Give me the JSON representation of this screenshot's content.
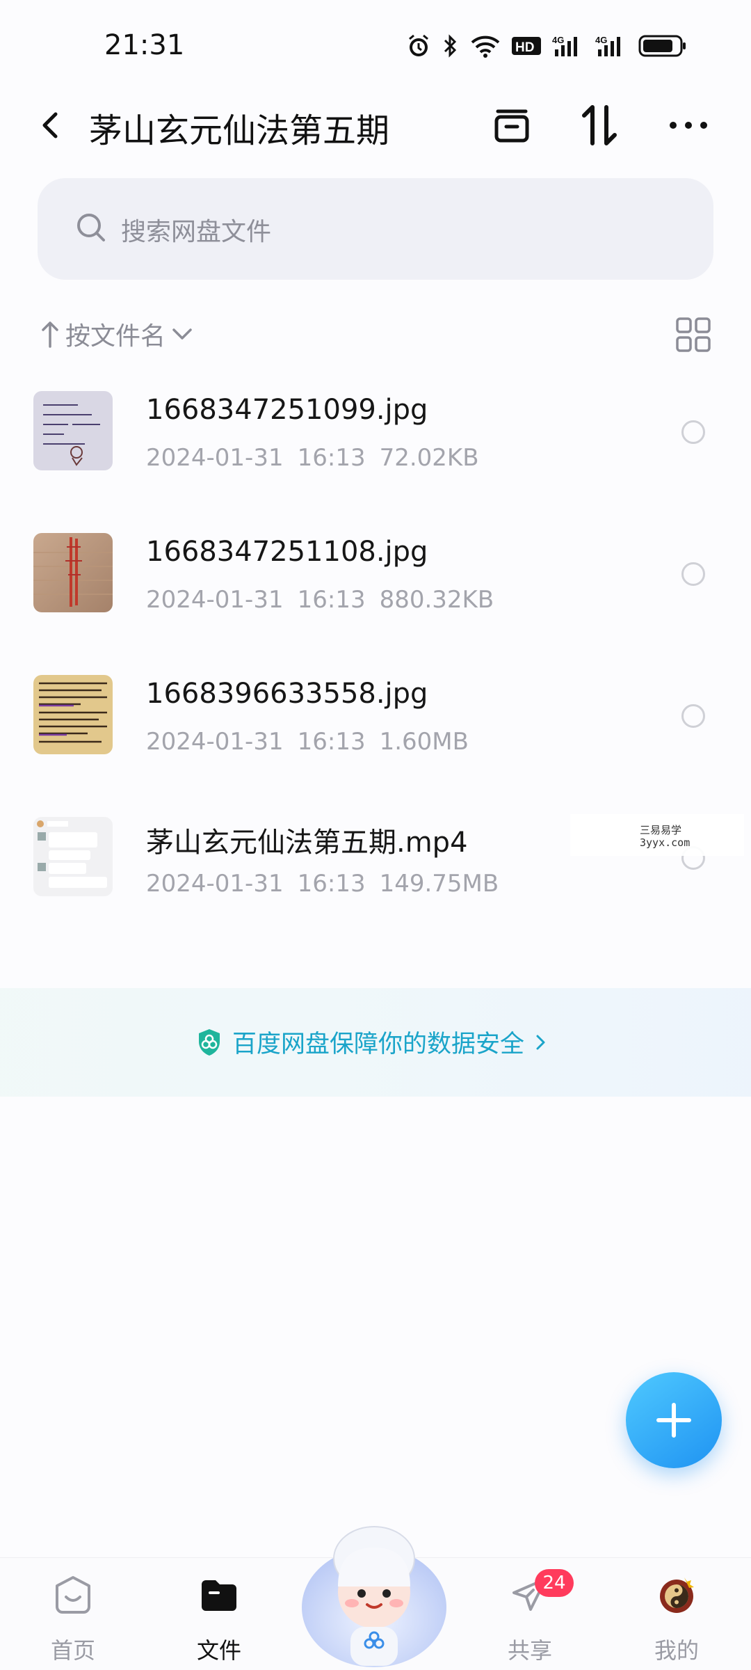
{
  "status_bar": {
    "time": "21:31",
    "icons": [
      "alarm-icon",
      "bluetooth-icon",
      "wifi-icon",
      "hd-icon",
      "signal-4g-icon",
      "signal-4g-icon",
      "battery-icon"
    ],
    "hd_label": "HD",
    "net_label": "4G"
  },
  "header": {
    "title": "茅山玄元仙法第五期",
    "actions": [
      "back-icon",
      "archive-icon",
      "transfer-icon",
      "more-icon"
    ]
  },
  "search": {
    "placeholder": "搜索网盘文件"
  },
  "sort": {
    "label": "按文件名"
  },
  "files": [
    {
      "name": "1668347251099.jpg",
      "date": "2024-01-31",
      "time": "16:13",
      "size": "72.02KB"
    },
    {
      "name": "1668347251108.jpg",
      "date": "2024-01-31",
      "time": "16:13",
      "size": "880.32KB"
    },
    {
      "name": "1668396633558.jpg",
      "date": "2024-01-31",
      "time": "16:13",
      "size": "1.60MB"
    },
    {
      "name": "茅山玄元仙法第五期.mp4",
      "date": "2024-01-31",
      "time": "16:13",
      "size": "149.75MB"
    }
  ],
  "watermark": {
    "line1": "三易易学",
    "line2": "3yyx.com"
  },
  "security_banner": {
    "text": "百度网盘保障你的数据安全",
    "accent": "#1aa4c9"
  },
  "fab": {
    "icon": "plus-icon",
    "color": "#2a9ff5"
  },
  "bottom_nav": {
    "items": [
      {
        "label": "首页",
        "icon": "home-icon"
      },
      {
        "label": "文件",
        "icon": "folder-icon",
        "active": true
      },
      {
        "label": "共享",
        "icon": "send-icon",
        "badge": "24"
      },
      {
        "label": "我的",
        "icon": "avatar"
      }
    ]
  }
}
